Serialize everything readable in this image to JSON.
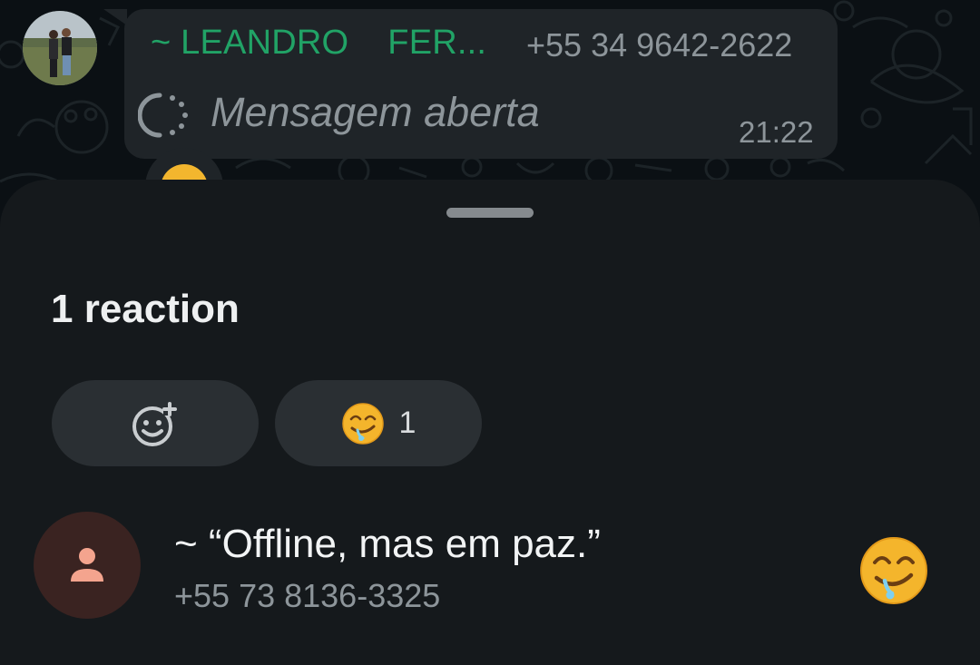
{
  "chat": {
    "sender_name": "~ LEANDRO    FER...",
    "sender_phone": "+55 34 9642-2622",
    "message": "Mensagem aberta",
    "time": "21:22",
    "sender_color": "#21a366"
  },
  "sheet": {
    "title": "1 reaction",
    "add_reaction_icon": "emoji-add-icon",
    "filters": [
      {
        "emoji": "drooling-face",
        "count": "1"
      }
    ],
    "reactors": [
      {
        "name": "~ “Offline, mas em paz.”",
        "phone": "+55 73 8136-3325",
        "reaction": "drooling-face",
        "avatar_icon": "person-icon"
      }
    ],
    "accent_avatar_bg": "#3a2321",
    "accent_avatar_fg": "#f4a48e"
  }
}
